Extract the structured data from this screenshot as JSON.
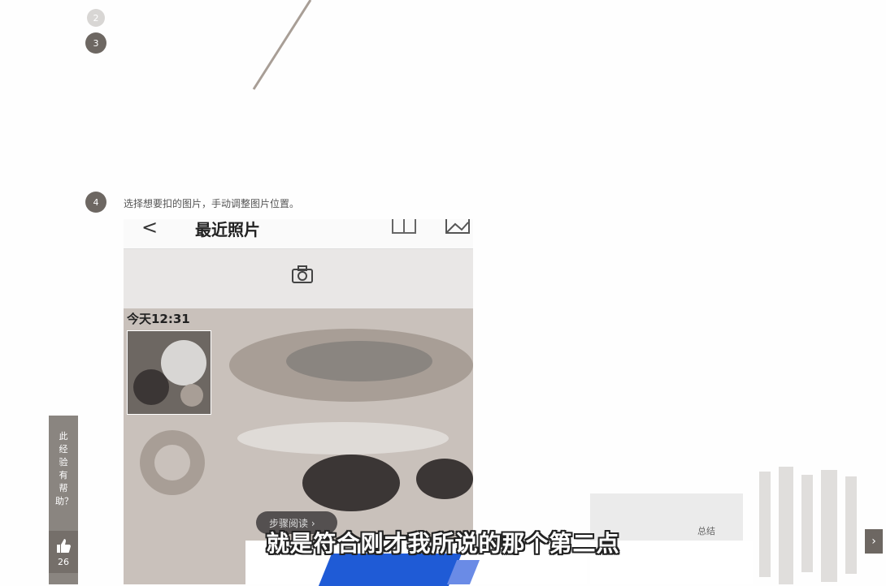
{
  "steps": {
    "step2_number": "2",
    "step3_number": "3",
    "step4_number": "4",
    "step4_text": "选择想要扣的图片，手动调整图片位置。"
  },
  "phone": {
    "back_glyph": "<",
    "title": "最近照片",
    "date_label": "今天12:31"
  },
  "sidebar": {
    "helpful_text": "此经验有帮助？",
    "like_count": "26"
  },
  "reading": {
    "label": "步骤阅读 ›"
  },
  "summary": {
    "label": "总结"
  },
  "nav": {
    "next_glyph": "›"
  },
  "caption": {
    "text": "就是符合刚才我所说的那个第二点"
  },
  "colors": {
    "step_badge": "#6d6762",
    "highlight_blue": "#1f5bd6"
  }
}
